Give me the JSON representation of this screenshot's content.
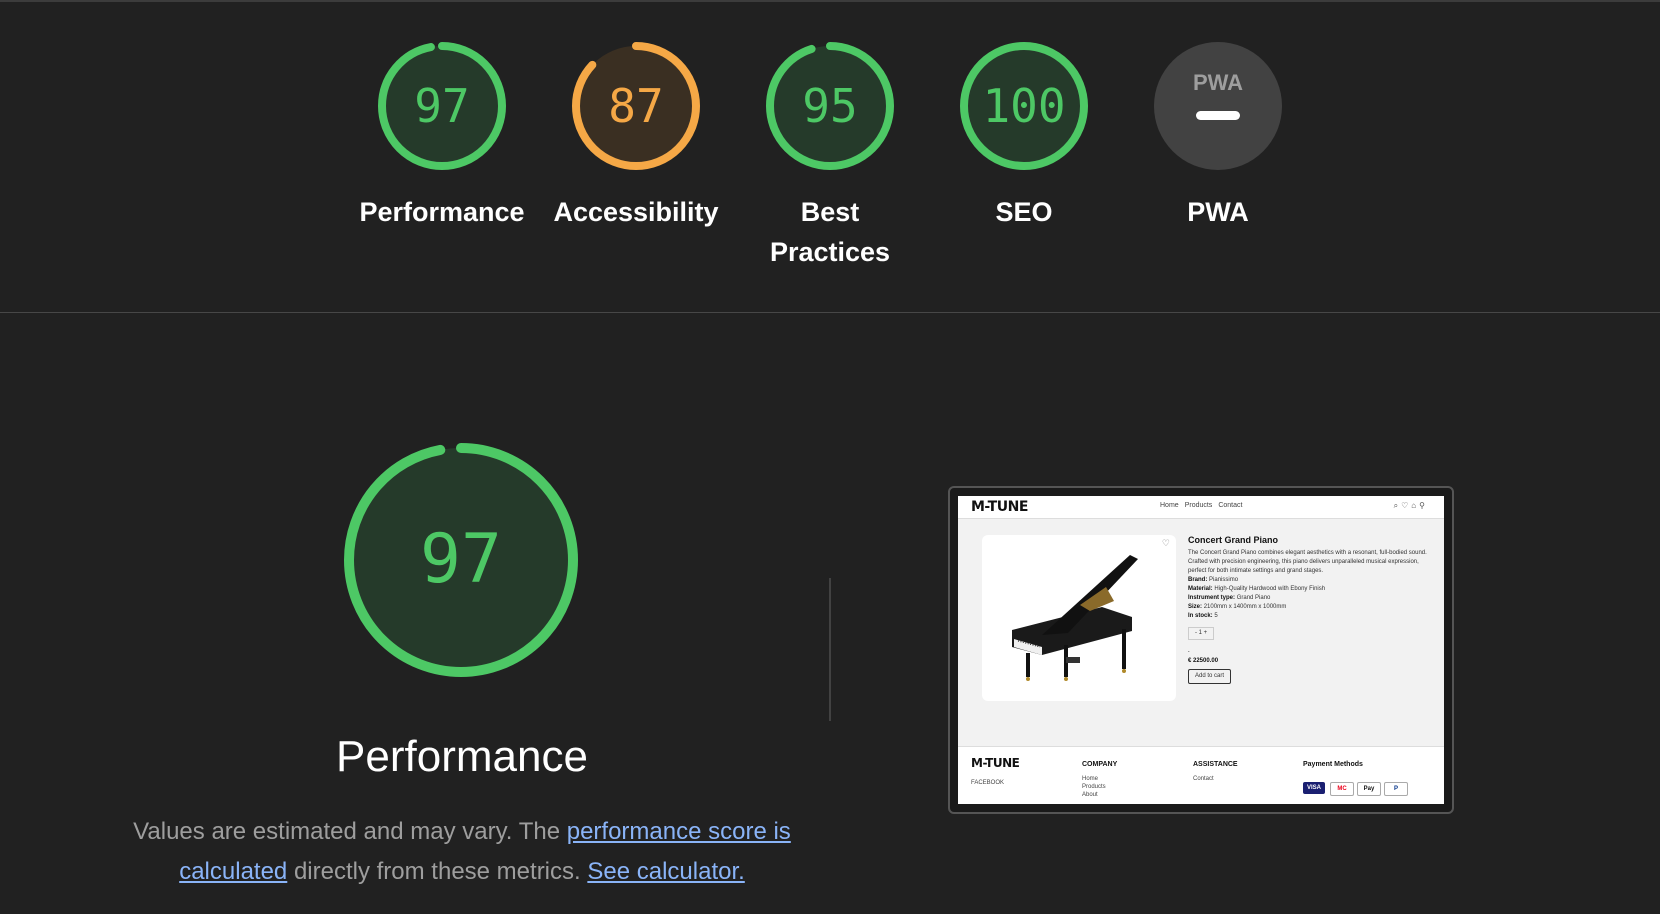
{
  "categories": [
    {
      "id": "performance",
      "score": "97",
      "label": "Performance",
      "color": "#4dc865",
      "fill": 0.97
    },
    {
      "id": "accessibility",
      "score": "87",
      "label": "Accessibility",
      "color": "#f5a846",
      "fill": 0.87
    },
    {
      "id": "best-practices",
      "score": "95",
      "label_line1": "Best",
      "label_line2": "Practices",
      "color": "#4dc865",
      "fill": 0.95
    },
    {
      "id": "seo",
      "score": "100",
      "label": "SEO",
      "color": "#4dc865",
      "fill": 1.0
    },
    {
      "id": "pwa",
      "badge": "PWA",
      "label": "PWA",
      "color": "#424242"
    }
  ],
  "detail": {
    "score": "97",
    "fill": 0.97,
    "title": "Performance",
    "desc_prefix": "Values are estimated and may vary. The ",
    "link_score": "performance score is calculated",
    "desc_middle": " directly from these metrics. ",
    "link_calculator": "See calculator."
  },
  "screenshot": {
    "logo": "M-TUNE",
    "nav": [
      "Home",
      "Products",
      "Contact"
    ],
    "product": {
      "title": "Concert Grand Piano",
      "description": "The Concert Grand Piano combines elegant aesthetics with a resonant, full-bodied sound. Crafted with precision engineering, this piano delivers unparalleled musical expression, perfect for both intimate settings and grand stages.",
      "brand_label": "Brand:",
      "brand": "Pianissimo",
      "material_label": "Material:",
      "material": "High-Quality Hardwood with Ebony Finish",
      "type_label": "Instrument type:",
      "type": "Grand Piano",
      "size_label": "Size:",
      "size": "2100mm x 1400mm x 1000mm",
      "stock_label": "In stock:",
      "stock": "5",
      "qty": "- 1 +",
      "price": "€ 22500.00",
      "add_to_cart": "Add to cart"
    },
    "footer": {
      "logo": "M-TUNE",
      "facebook": "FACEBOOK",
      "company_heading": "COMPANY",
      "company_links": [
        "Home",
        "Products",
        "About"
      ],
      "assistance_heading": "ASSISTANCE",
      "assistance_links": [
        "Contact"
      ],
      "payment_heading": "Payment Methods",
      "payments": [
        "VISA",
        "MC",
        "Pay",
        "P"
      ]
    }
  }
}
